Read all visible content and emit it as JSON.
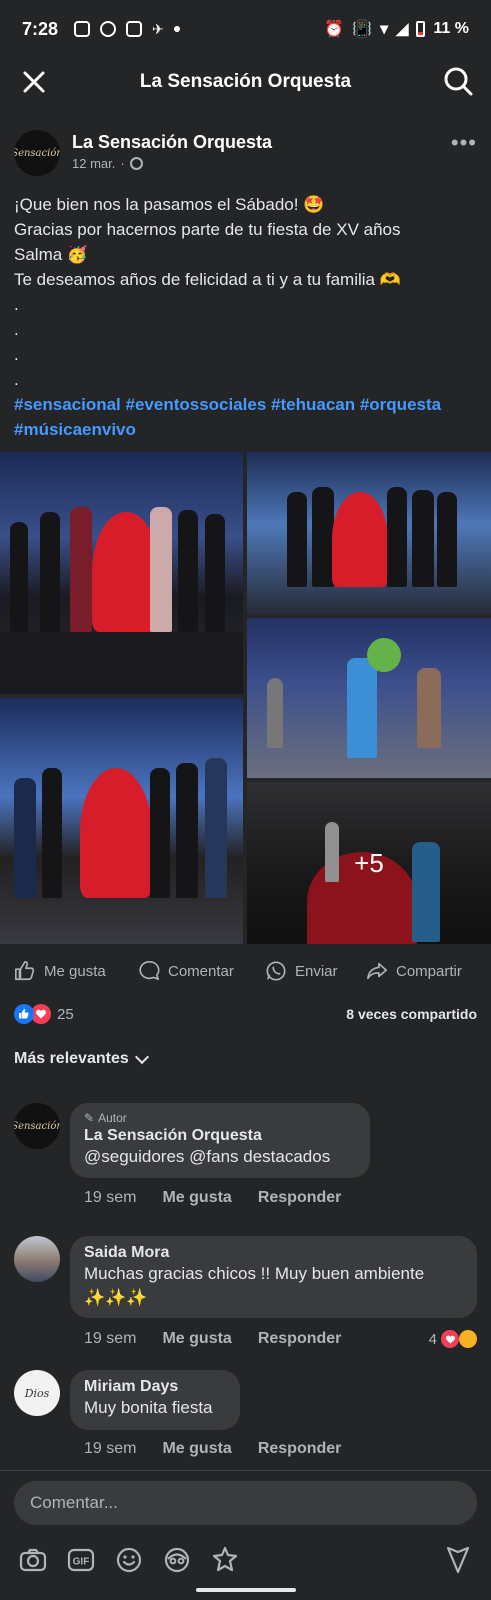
{
  "status_bar": {
    "time": "7:28",
    "battery": "11 %"
  },
  "topbar": {
    "title": "La Sensación Orquesta"
  },
  "post": {
    "page_name": "La Sensación Orquesta",
    "date": "12 mar.",
    "avatar_text": "Sensación",
    "lines": [
      "¡Que bien nos la pasamos el Sábado! 🤩",
      "Gracias por hacernos parte de tu fiesta de XV años",
      "Salma 🥳",
      "Te deseamos años de felicidad a ti y a tu familia 🫶",
      ".",
      ".",
      ".",
      "."
    ],
    "hashtags": "#sensacional #eventossociales #tehuacan #orquesta #músicaenvivo",
    "more_photos": "+5"
  },
  "actions": {
    "like": "Me gusta",
    "comment": "Comentar",
    "send": "Enviar",
    "share": "Compartir"
  },
  "reactions": {
    "count": "25",
    "shares": "8 veces compartido"
  },
  "sort": {
    "label": "Más relevantes"
  },
  "comments": [
    {
      "badge": "Autor",
      "name": "La Sensación Orquesta",
      "text": "@seguidores @fans destacados",
      "time": "19 sem",
      "like": "Me gusta",
      "reply": "Responder"
    },
    {
      "name": "Saida Mora",
      "text": "Muchas gracias chicos !! Muy buen ambiente ✨✨✨",
      "time": "19 sem",
      "like": "Me gusta",
      "reply": "Responder",
      "reactions": "4"
    },
    {
      "name": "Miriam Days",
      "avatar_text": "Dios",
      "text": "Muy bonita fiesta",
      "time": "19 sem",
      "like": "Me gusta",
      "reply": "Responder"
    }
  ],
  "composer": {
    "placeholder": "Comentar..."
  },
  "colors": {
    "background": "#242526",
    "bubble": "#3a3b3c",
    "link": "#4599ff",
    "like_blue": "#1877f2",
    "love_red": "#f33e58"
  }
}
